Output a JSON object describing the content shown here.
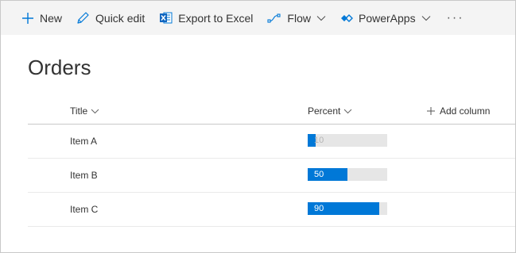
{
  "commandbar": {
    "new_label": "New",
    "quick_edit_label": "Quick edit",
    "export_label": "Export to Excel",
    "flow_label": "Flow",
    "powerapps_label": "PowerApps",
    "more_label": "···"
  },
  "list": {
    "title": "Orders",
    "columns": {
      "title": "Title",
      "percent": "Percent",
      "add_column": "Add column"
    },
    "rows": [
      {
        "title": "Item A",
        "percent": 10,
        "percent_label": "10"
      },
      {
        "title": "Item B",
        "percent": 50,
        "percent_label": "50"
      },
      {
        "title": "Item C",
        "percent": 90,
        "percent_label": "90"
      }
    ]
  },
  "colors": {
    "accent": "#0078d7",
    "bar_track": "#e6e6e6",
    "commandbar_bg": "#f4f4f4"
  }
}
